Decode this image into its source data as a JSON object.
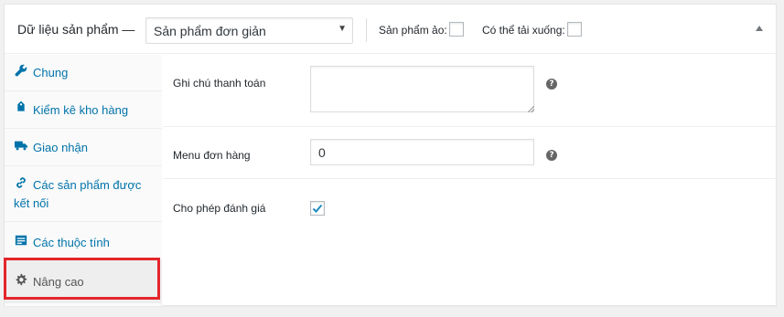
{
  "header": {
    "title": "Dữ liệu sản phẩm —",
    "product_type": "Sản phẩm đơn giản",
    "virtual_label": "Sản phẩm ảo:",
    "virtual_checked": false,
    "downloadable_label": "Có thể tải xuống:",
    "downloadable_checked": false
  },
  "tabs": [
    {
      "label": "Chung",
      "icon": "wrench-icon"
    },
    {
      "label": "Kiểm kê kho hàng",
      "icon": "tag-icon"
    },
    {
      "label": "Giao nhận",
      "icon": "truck-icon"
    },
    {
      "label": "Các sản phẩm được kết nối",
      "icon": "link-icon"
    },
    {
      "label": "Các thuộc tính",
      "icon": "list-icon"
    },
    {
      "label": "Nâng cao",
      "icon": "gear-icon",
      "active": true
    }
  ],
  "advanced": {
    "purchase_note_label": "Ghi chú thanh toán",
    "purchase_note_value": "",
    "menu_order_label": "Menu đơn hàng",
    "menu_order_value": "0",
    "enable_reviews_label": "Cho phép đánh giá",
    "enable_reviews_checked": true
  },
  "colors": {
    "link": "#0073aa",
    "highlight": "#e4262b",
    "check": "#1e8cbe"
  }
}
